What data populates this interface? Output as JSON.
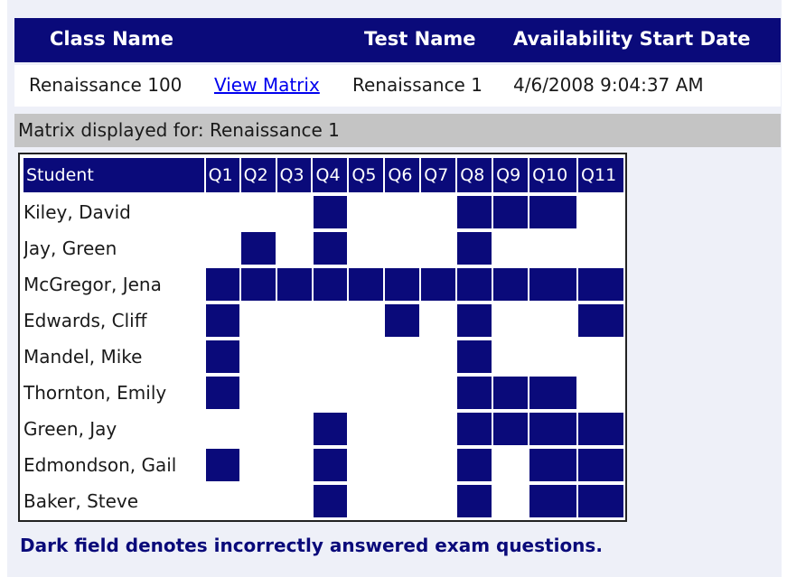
{
  "header": {
    "class_name": "Class Name",
    "test_name": "Test Name",
    "availability": "Availability Start Date"
  },
  "info": {
    "class_value": "Renaissance 100",
    "view_matrix_link": "View Matrix",
    "test_value": "Renaissance 1",
    "date_value": "4/6/2008 9:04:37 AM"
  },
  "caption": "Matrix displayed for: Renaissance 1",
  "matrix": {
    "student_header": "Student",
    "questions": [
      "Q1",
      "Q2",
      "Q3",
      "Q4",
      "Q5",
      "Q6",
      "Q7",
      "Q8",
      "Q9",
      "Q10",
      "Q11"
    ],
    "students": [
      {
        "name": "Kiley, David",
        "incorrect": [
          "Q4",
          "Q8",
          "Q9",
          "Q10"
        ]
      },
      {
        "name": "Jay, Green",
        "incorrect": [
          "Q2",
          "Q4",
          "Q8"
        ]
      },
      {
        "name": "McGregor, Jena",
        "incorrect": [
          "Q1",
          "Q2",
          "Q3",
          "Q4",
          "Q5",
          "Q6",
          "Q7",
          "Q8",
          "Q9",
          "Q10",
          "Q11"
        ]
      },
      {
        "name": "Edwards, Cliff",
        "incorrect": [
          "Q1",
          "Q6",
          "Q8",
          "Q11"
        ]
      },
      {
        "name": "Mandel, Mike",
        "incorrect": [
          "Q1",
          "Q8"
        ]
      },
      {
        "name": "Thornton, Emily",
        "incorrect": [
          "Q1",
          "Q8",
          "Q9",
          "Q10"
        ]
      },
      {
        "name": "Green, Jay",
        "incorrect": [
          "Q4",
          "Q8",
          "Q9",
          "Q10",
          "Q11"
        ]
      },
      {
        "name": "Edmondson, Gail",
        "incorrect": [
          "Q1",
          "Q4",
          "Q8",
          "Q10",
          "Q11"
        ]
      },
      {
        "name": "Baker, Steve",
        "incorrect": [
          "Q4",
          "Q8",
          "Q10",
          "Q11"
        ]
      }
    ]
  },
  "note": "Dark field denotes incorrectly answered exam questions.",
  "colors": {
    "dark": "#0a0a7a",
    "caption_bg": "#c4c4c4",
    "link": "#0000ee"
  }
}
